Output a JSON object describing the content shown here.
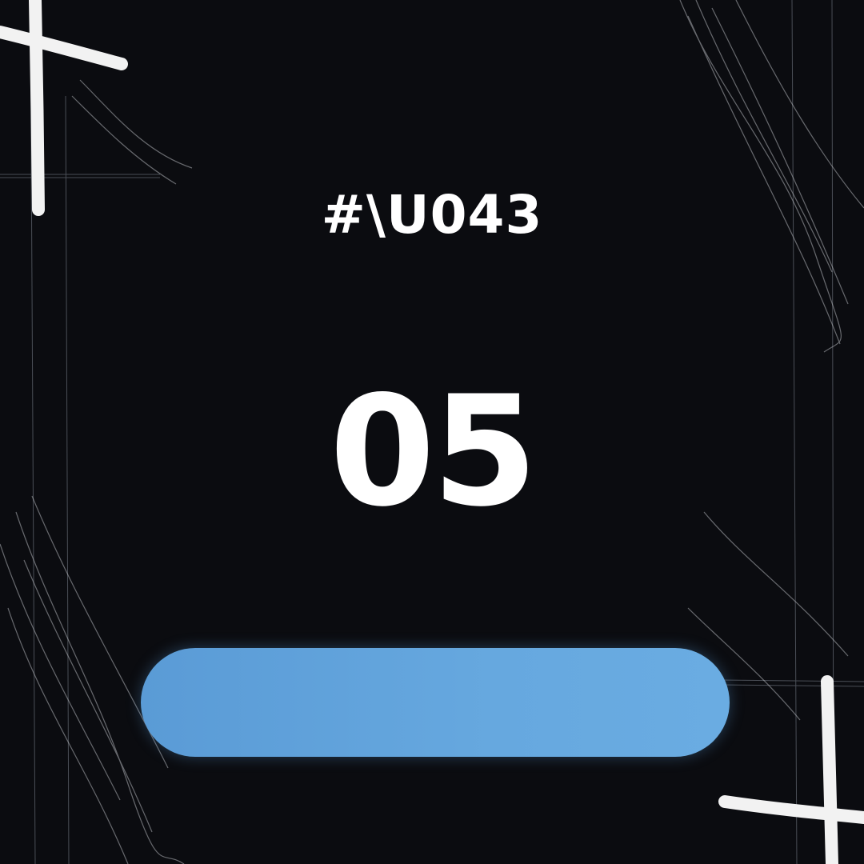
{
  "tag": "#\\U043",
  "number": "05",
  "colors": {
    "background": "#0b0c10",
    "text": "#ffffff",
    "pill": "#5fa3dc",
    "decoration": "#f2f2f2"
  },
  "icons": [
    "plus-sign-icon",
    "plus-sign-icon"
  ]
}
